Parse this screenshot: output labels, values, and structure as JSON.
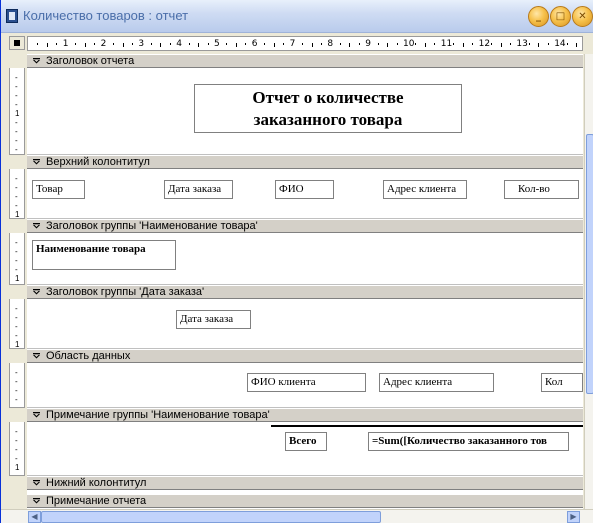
{
  "window": {
    "title": "Количество товаров : отчет",
    "minimize_glyph": "_",
    "maximize_glyph": "□",
    "close_glyph": "✕"
  },
  "ruler": {
    "ticks": [
      "1",
      "2",
      "3",
      "4",
      "5",
      "6",
      "7",
      "8",
      "9",
      "10",
      "11",
      "12",
      "13",
      "14"
    ]
  },
  "sections": {
    "report_header": {
      "label": "Заголовок отчета",
      "title_line1": "Отчет о количестве",
      "title_line2": "заказанного товара"
    },
    "page_header": {
      "label": "Верхний колонтитул",
      "columns": [
        "Товар",
        "Дата заказа",
        "ФИО",
        "Адрес клиента",
        "Кол-во"
      ]
    },
    "group_header_product": {
      "label": "Заголовок группы 'Наименование товара'",
      "field": "Наименование товара"
    },
    "group_header_date": {
      "label": "Заголовок группы 'Дата заказа'",
      "field": "Дата заказа"
    },
    "detail": {
      "label": "Область данных",
      "fields": [
        "ФИО  клиента",
        "Адрес клиента",
        "Кол"
      ]
    },
    "group_footer_product": {
      "label": "Примечание группы 'Наименование товара'",
      "total_label": "Всего",
      "total_expr": "=Sum([Количество заказанного тов"
    },
    "page_footer": {
      "label": "Нижний колонтитул"
    },
    "report_footer": {
      "label": "Примечание отчета"
    }
  }
}
